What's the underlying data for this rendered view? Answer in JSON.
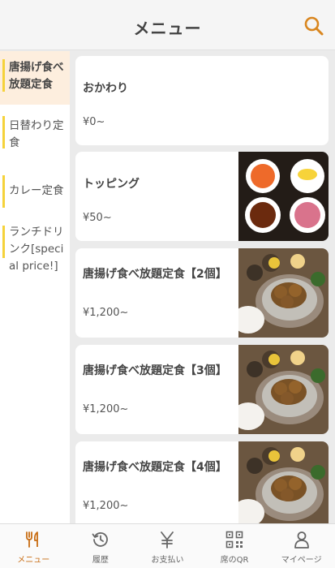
{
  "header": {
    "title": "メニュー",
    "search_icon": "search-icon"
  },
  "sidebar": {
    "items": [
      {
        "label": "唐揚げ食べ放題定食",
        "active": true
      },
      {
        "label": "日替わり定食",
        "active": false
      },
      {
        "label": "カレー定食",
        "active": false
      },
      {
        "label": "ランチドリンク[special price!]",
        "active": false
      }
    ]
  },
  "menu": {
    "items": [
      {
        "name": "おかわり",
        "price": "¥0~",
        "image": false
      },
      {
        "name": "トッピング",
        "price": "¥50~",
        "image": "toppings"
      },
      {
        "name": "唐揚げ食べ放題定食【2個】",
        "price": "¥1,200~",
        "image": "karaage"
      },
      {
        "name": "唐揚げ食べ放題定食【3個】",
        "price": "¥1,200~",
        "image": "karaage"
      },
      {
        "name": "唐揚げ食べ放題定食【4個】",
        "price": "¥1,200~",
        "image": "karaage"
      }
    ]
  },
  "nav": {
    "items": [
      {
        "label": "メニュー",
        "icon": "fork-knife-icon",
        "active": true
      },
      {
        "label": "履歴",
        "icon": "history-icon",
        "active": false
      },
      {
        "label": "お支払い",
        "icon": "yen-icon",
        "active": false
      },
      {
        "label": "席のQR",
        "icon": "qr-code-icon",
        "active": false
      },
      {
        "label": "マイページ",
        "icon": "user-icon",
        "active": false
      }
    ]
  },
  "colors": {
    "accent": "#d9861f",
    "active_nav": "#c86c12",
    "sidebar_active_bg": "#fdeede",
    "sidebar_marker": "#f5d23b"
  }
}
